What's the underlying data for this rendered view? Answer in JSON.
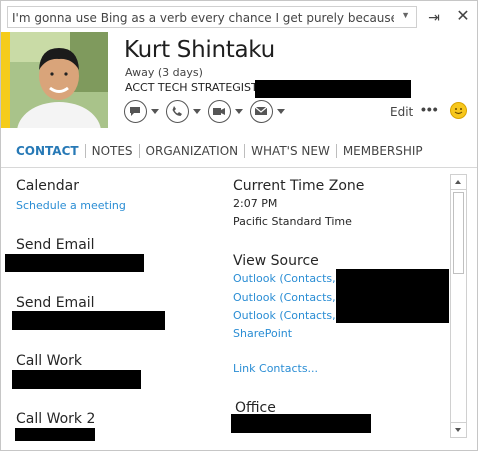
{
  "note": {
    "text": "I'm gonna use Bing as a verb every chance I get purely because it annoys"
  },
  "window": {
    "pin_icon": "⇥",
    "close_icon": "✕"
  },
  "contact": {
    "name": "Kurt Shintaku",
    "status": "Away (3 days)",
    "title": "ACCT TECH STRATEGIST",
    "presence_color": "#f5cc1b"
  },
  "actions": {
    "edit_label": "Edit",
    "more_label": "•••",
    "comm_icons": [
      "im-icon",
      "phone-icon",
      "video-icon",
      "email-icon"
    ]
  },
  "tabs": [
    "CONTACT",
    "NOTES",
    "ORGANIZATION",
    "WHAT'S NEW",
    "MEMBERSHIP"
  ],
  "active_tab": "CONTACT",
  "left_column": {
    "calendar_label": "Calendar",
    "schedule_link": "Schedule a meeting",
    "send_email_1": "Send Email",
    "send_email_2": "Send Email",
    "call_work": "Call Work",
    "call_work_2": "Call Work 2"
  },
  "right_column": {
    "timezone_label": "Current Time Zone",
    "time": "2:07 PM",
    "timezone": "Pacific Standard Time",
    "view_source_label": "View Source",
    "sources": [
      "Outlook (Contacts,",
      "Outlook (Contacts,",
      "Outlook (Contacts,",
      "SharePoint"
    ],
    "link_contacts": "Link Contacts...",
    "office_label": "Office"
  },
  "colors": {
    "accent": "#2779b6",
    "link": "#2a8dd4"
  }
}
